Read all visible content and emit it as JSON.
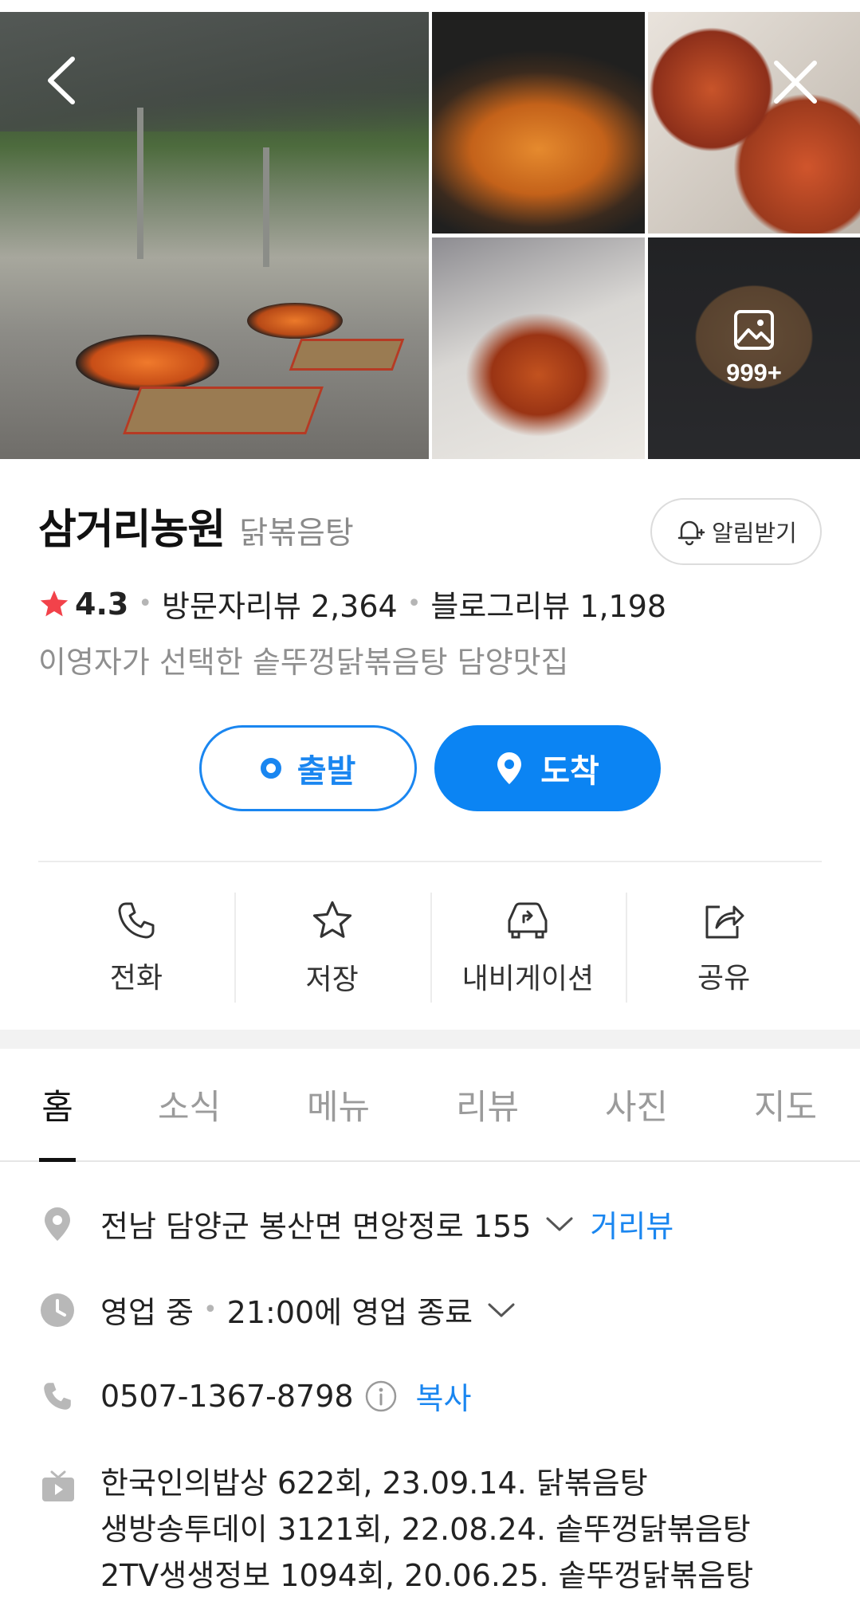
{
  "gallery": {
    "more_count": "999+"
  },
  "place": {
    "name": "삼거리농원",
    "category": "닭볶음탕",
    "alarm_label": "알림받기"
  },
  "rating": {
    "score": "4.3",
    "visitor_reviews": "방문자리뷰 2,364",
    "blog_reviews": "블로그리뷰 1,198"
  },
  "tagline": "이영자가 선택한 솥뚜껑닭볶음탕 담양맛집",
  "route": {
    "depart_label": "출발",
    "arrive_label": "도착"
  },
  "actions": [
    {
      "label": "전화",
      "icon": "phone-icon"
    },
    {
      "label": "저장",
      "icon": "star-icon"
    },
    {
      "label": "내비게이션",
      "icon": "car-icon"
    },
    {
      "label": "공유",
      "icon": "share-icon"
    }
  ],
  "tabs": [
    "홈",
    "소식",
    "메뉴",
    "리뷰",
    "사진",
    "지도"
  ],
  "info": {
    "address": "전남 담양군 봉산면 면앙정로 155",
    "street_view": "거리뷰",
    "status": "영업 중",
    "close_time": "21:00에 영업 종료",
    "phone": "0507-1367-8798",
    "copy": "복사",
    "broadcasts": [
      "한국인의밥상 622회, 23.09.14. 닭볶음탕",
      "생방송투데이 3121회, 22.08.24. 솥뚜껑닭볶음탕",
      "2TV생생정보 1094회, 20.06.25. 솥뚜껑닭볶음탕"
    ]
  },
  "colors": {
    "accent": "#0b84f3",
    "star": "#f2424a",
    "muted": "#8f8f8f"
  }
}
